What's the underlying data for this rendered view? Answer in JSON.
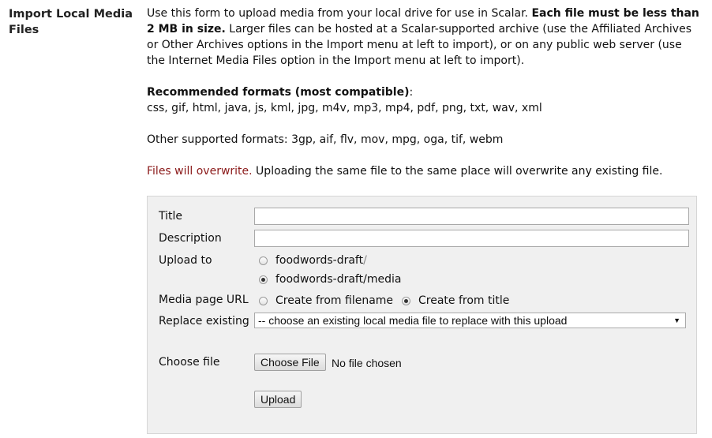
{
  "page": {
    "title": "Import Local Media Files"
  },
  "intro": {
    "p1_a": "Use this form to upload media from your local drive for use in Scalar. ",
    "p1_bold": "Each file must be less than 2 MB in size.",
    "p1_b": " Larger files can be hosted at a Scalar-supported archive (use the Affiliated Archives or Other Archives options in the Import menu at left to import), or on any public web server (use the Internet Media Files option in the Import menu at left to import).",
    "recommended_heading": "Recommended formats (most compatible)",
    "recommended_colon": ":",
    "recommended_list": "css, gif, html, java, js, kml, jpg, m4v, mp3, mp4, pdf, png, txt, wav, xml",
    "other_formats": "Other supported formats: 3gp, aif, flv, mov, mpg, oga, tif, webm",
    "overwrite_warning": "Files will overwrite.",
    "overwrite_text": " Uploading the same file to the same place will overwrite any existing file."
  },
  "form": {
    "title_label": "Title",
    "title_value": "",
    "description_label": "Description",
    "description_value": "",
    "upload_to_label": "Upload to",
    "upload_to_options": [
      {
        "name": "foodwords-draft",
        "suffix": "/",
        "checked": false
      },
      {
        "name": "foodwords-draft/media",
        "suffix": "",
        "checked": true
      }
    ],
    "media_url_label": "Media page URL",
    "media_url_options": [
      {
        "label": "Create from filename",
        "checked": false
      },
      {
        "label": "Create from title",
        "checked": true
      }
    ],
    "replace_label": "Replace existing",
    "replace_selected": "-- choose an existing local media file to replace with this upload",
    "choose_file_label": "Choose file",
    "choose_file_button": "Choose File",
    "file_status": "No file chosen",
    "upload_button": "Upload"
  }
}
